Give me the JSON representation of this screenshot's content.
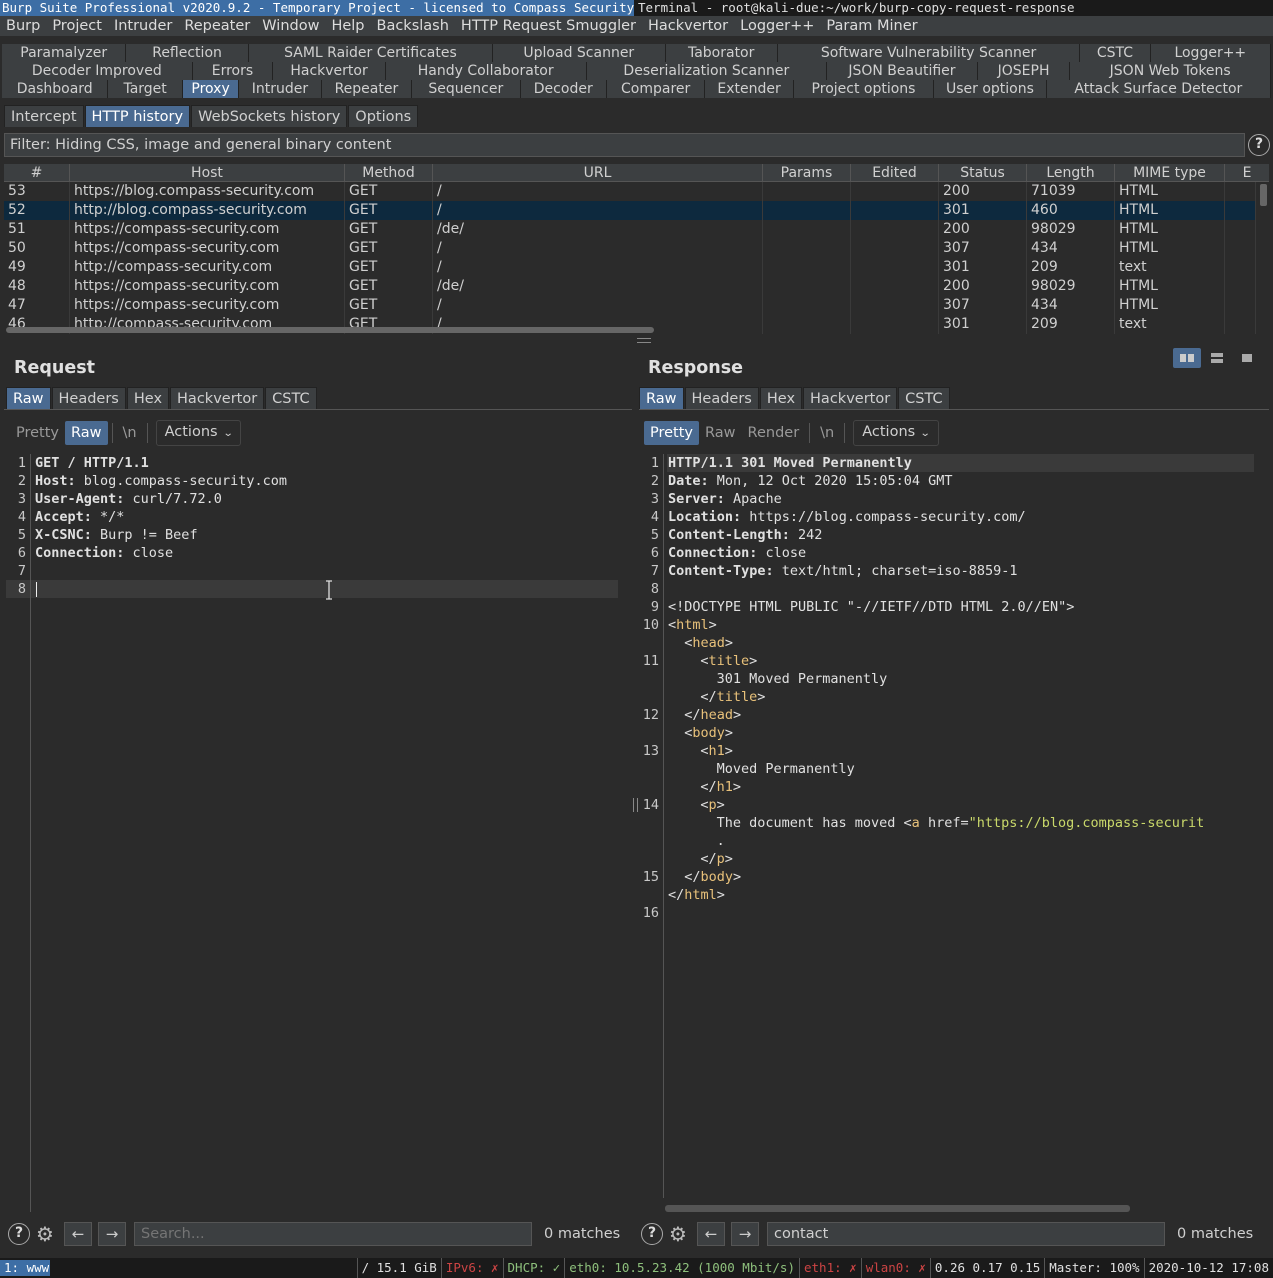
{
  "titlebar": {
    "active_window": "Burp Suite Professional v2020.9.2 - Temporary Project - licensed to Compass Security Schw…",
    "other_window": "Terminal - root@kali-due:~/work/burp-copy-request-response"
  },
  "menubar": [
    "Burp",
    "Project",
    "Intruder",
    "Repeater",
    "Window",
    "Help",
    "Backslash",
    "HTTP Request Smuggler",
    "Hackvertor",
    "Logger++",
    "Param Miner"
  ],
  "tabs": {
    "row1": [
      "Paramalyzer",
      "Reflection",
      "SAML Raider Certificates",
      "Upload Scanner",
      "Taborator",
      "Software Vulnerability Scanner",
      "CSTC",
      "Logger++"
    ],
    "row2": [
      "Decoder Improved",
      "Errors",
      "Hackvertor",
      "Handy Collaborator",
      "Deserialization Scanner",
      "JSON Beautifier",
      "JOSEPH",
      "JSON Web Tokens"
    ],
    "row3": [
      "Dashboard",
      "Target",
      "Proxy",
      "Intruder",
      "Repeater",
      "Sequencer",
      "Decoder",
      "Comparer",
      "Extender",
      "Project options",
      "User options",
      "Attack Surface Detector"
    ],
    "row3_selected": "Proxy"
  },
  "proxy_tabs": [
    "Intercept",
    "HTTP history",
    "WebSockets history",
    "Options"
  ],
  "proxy_tab_selected": "HTTP history",
  "filter": {
    "text": "Filter: Hiding CSS, image and general binary content",
    "help": "?"
  },
  "history": {
    "columns": [
      "#",
      "Host",
      "Method",
      "URL",
      "Params",
      "Edited",
      "Status",
      "Length",
      "MIME type",
      "E"
    ],
    "rows": [
      {
        "num": "53",
        "host": "https://blog.compass-security.com",
        "method": "GET",
        "url": "/",
        "status": "200",
        "length": "71039",
        "mime": "HTML"
      },
      {
        "num": "52",
        "host": "http://blog.compass-security.com",
        "method": "GET",
        "url": "/",
        "status": "301",
        "length": "460",
        "mime": "HTML"
      },
      {
        "num": "51",
        "host": "https://compass-security.com",
        "method": "GET",
        "url": "/de/",
        "status": "200",
        "length": "98029",
        "mime": "HTML"
      },
      {
        "num": "50",
        "host": "https://compass-security.com",
        "method": "GET",
        "url": "/",
        "status": "307",
        "length": "434",
        "mime": "HTML"
      },
      {
        "num": "49",
        "host": "http://compass-security.com",
        "method": "GET",
        "url": "/",
        "status": "301",
        "length": "209",
        "mime": "text"
      },
      {
        "num": "48",
        "host": "https://compass-security.com",
        "method": "GET",
        "url": "/de/",
        "status": "200",
        "length": "98029",
        "mime": "HTML"
      },
      {
        "num": "47",
        "host": "https://compass-security.com",
        "method": "GET",
        "url": "/",
        "status": "307",
        "length": "434",
        "mime": "HTML"
      },
      {
        "num": "46",
        "host": "http://compass-security.com",
        "method": "GET",
        "url": "/",
        "status": "301",
        "length": "209",
        "mime": "text"
      }
    ],
    "selected_num": "52"
  },
  "request": {
    "title": "Request",
    "tabs": [
      "Raw",
      "Headers",
      "Hex",
      "Hackvertor",
      "CSTC"
    ],
    "tab_selected": "Raw",
    "views": [
      "Pretty",
      "Raw",
      "\\n"
    ],
    "view_selected": "Raw",
    "actions": "Actions",
    "lines": [
      {
        "n": "1",
        "key": "",
        "val": "GET / HTTP/1.1"
      },
      {
        "n": "2",
        "key": "Host:",
        "val": " blog.compass-security.com"
      },
      {
        "n": "3",
        "key": "User-Agent:",
        "val": " curl/7.72.0"
      },
      {
        "n": "4",
        "key": "Accept:",
        "val": " */*"
      },
      {
        "n": "5",
        "key": "X-CSNC:",
        "val": " Burp != Beef"
      },
      {
        "n": "6",
        "key": "Connection:",
        "val": " close"
      },
      {
        "n": "7",
        "key": "",
        "val": ""
      },
      {
        "n": "8",
        "key": "",
        "val": ""
      }
    ],
    "search_placeholder": "Search...",
    "search_value": "",
    "matches": "0 matches"
  },
  "response": {
    "title": "Response",
    "tabs": [
      "Raw",
      "Headers",
      "Hex",
      "Hackvertor",
      "CSTC"
    ],
    "tab_selected": "Raw",
    "views": [
      "Pretty",
      "Raw",
      "Render",
      "\\n"
    ],
    "view_selected": "Pretty",
    "actions": "Actions",
    "headers": [
      {
        "n": "1",
        "key": "",
        "val": "HTTP/1.1 301 Moved Permanently"
      },
      {
        "n": "2",
        "key": "Date:",
        "val": " Mon, 12 Oct 2020 15:05:04 GMT"
      },
      {
        "n": "3",
        "key": "Server:",
        "val": " Apache"
      },
      {
        "n": "4",
        "key": "Location:",
        "val": " https://blog.compass-security.com/"
      },
      {
        "n": "5",
        "key": "Content-Length:",
        "val": " 242"
      },
      {
        "n": "6",
        "key": "Connection:",
        "val": " close"
      },
      {
        "n": "7",
        "key": "Content-Type:",
        "val": " text/html; charset=iso-8859-1"
      }
    ],
    "body": {
      "doctype": "<!DOCTYPE HTML PUBLIC \"-//IETF//DTD HTML 2.0//EN\">",
      "title_text": "301 Moved Permanently",
      "h1_text": "Moved Permanently",
      "p_text": "The document has moved ",
      "href": "https://blog.compass-securit",
      "dot": "."
    },
    "line_numbers": [
      "8",
      "9",
      "10",
      "11",
      "12",
      "13",
      "14",
      "15",
      "16"
    ],
    "search_value": "contact",
    "matches": "0 matches"
  },
  "statusbar": {
    "workspace": "1: www",
    "segments": [
      {
        "text": "/ 15.1 GiB",
        "style": "normal"
      },
      {
        "text": "IPv6: ✗",
        "style": "red"
      },
      {
        "text": "DHCP: ✓",
        "style": "green"
      },
      {
        "text": "eth0: 10.5.23.42 (1000 Mbit/s)",
        "style": "green"
      },
      {
        "text": "eth1: ✗",
        "style": "red"
      },
      {
        "text": "wlan0: ✗",
        "style": "red"
      },
      {
        "text": "0.26 0.17 0.15",
        "style": "normal"
      },
      {
        "text": "Master: 100%",
        "style": "normal"
      },
      {
        "text": "2020-10-12 17:08",
        "style": "normal"
      }
    ]
  },
  "colors": {
    "accent": "#4a6a91",
    "selected_row": "#0d293e",
    "bg": "#2b2b2b",
    "tag": "#e8c17a",
    "string": "#c9d86a"
  }
}
